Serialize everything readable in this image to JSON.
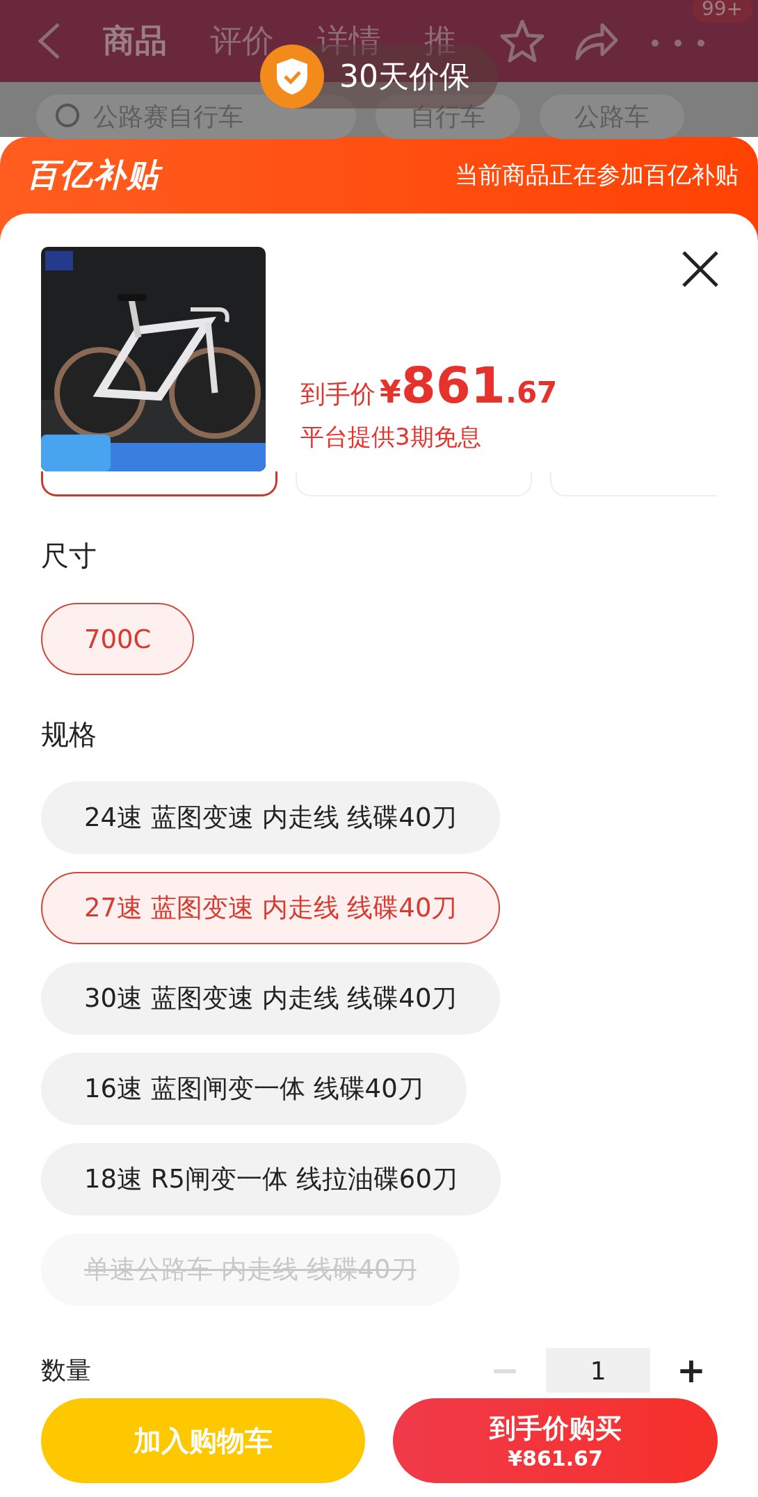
{
  "nav": {
    "tabs": [
      {
        "label": "商品",
        "selected": true
      },
      {
        "label": "评价",
        "selected": false
      },
      {
        "label": "详情",
        "selected": false
      },
      {
        "label": "推",
        "selected": false
      }
    ],
    "badge": "99+"
  },
  "toast": {
    "text": "30天价保"
  },
  "search": {
    "query": "公路赛自行车",
    "chips": [
      "自行车",
      "公路车"
    ]
  },
  "banner": {
    "logo": "百亿补贴",
    "message": "当前商品正在参加百亿补贴"
  },
  "product": {
    "price_label": "到手价",
    "currency": "¥",
    "price_integer": "861",
    "price_decimal": ".67",
    "note": "平台提供3期免息"
  },
  "color_options": [
    {
      "selected": true
    },
    {
      "selected": false
    },
    {
      "selected": false
    }
  ],
  "sections": [
    {
      "title": "尺寸",
      "options": [
        {
          "label": "700C",
          "selected": true,
          "disabled": false
        }
      ]
    },
    {
      "title": "规格",
      "options": [
        {
          "label": "24速 蓝图变速 内走线 线碟40刀",
          "selected": false,
          "disabled": false
        },
        {
          "label": "27速 蓝图变速 内走线 线碟40刀",
          "selected": true,
          "disabled": false
        },
        {
          "label": "30速 蓝图变速 内走线 线碟40刀",
          "selected": false,
          "disabled": false
        },
        {
          "label": "16速 蓝图闸变一体 线碟40刀",
          "selected": false,
          "disabled": false
        },
        {
          "label": "18速 R5闸变一体 线拉油碟60刀",
          "selected": false,
          "disabled": false
        },
        {
          "label": "单速公路车 内走线 线碟40刀",
          "selected": false,
          "disabled": true
        }
      ]
    }
  ],
  "quantity": {
    "label": "数量",
    "value": "1",
    "minus": {
      "symbol": "−",
      "disabled": true
    },
    "plus": {
      "symbol": "+",
      "disabled": false
    }
  },
  "actions": {
    "cart": "加入购物车",
    "buy": "到手价购买",
    "buy_price": "¥861.67"
  }
}
